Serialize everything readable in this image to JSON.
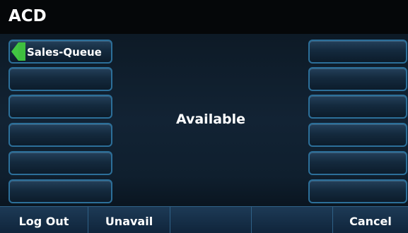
{
  "screen": {
    "title": "ACD",
    "status_text": "Available"
  },
  "line_keys_left": [
    {
      "label": "Sales-Queue",
      "indicator": "green-active",
      "indicator_color": "#3fbf3f"
    },
    {
      "label": ""
    },
    {
      "label": ""
    },
    {
      "label": ""
    },
    {
      "label": ""
    },
    {
      "label": ""
    }
  ],
  "line_keys_right": [
    {
      "label": ""
    },
    {
      "label": ""
    },
    {
      "label": ""
    },
    {
      "label": ""
    },
    {
      "label": ""
    },
    {
      "label": ""
    }
  ],
  "softkeys": [
    {
      "label": "Log Out"
    },
    {
      "label": "Unavail"
    },
    {
      "label": ""
    },
    {
      "label": ""
    },
    {
      "label": "Cancel"
    }
  ],
  "colors": {
    "accent_border": "#2c6f99",
    "background": "#0f1f2e",
    "title_bar": "#050709",
    "active_indicator": "#3fbf3f"
  }
}
